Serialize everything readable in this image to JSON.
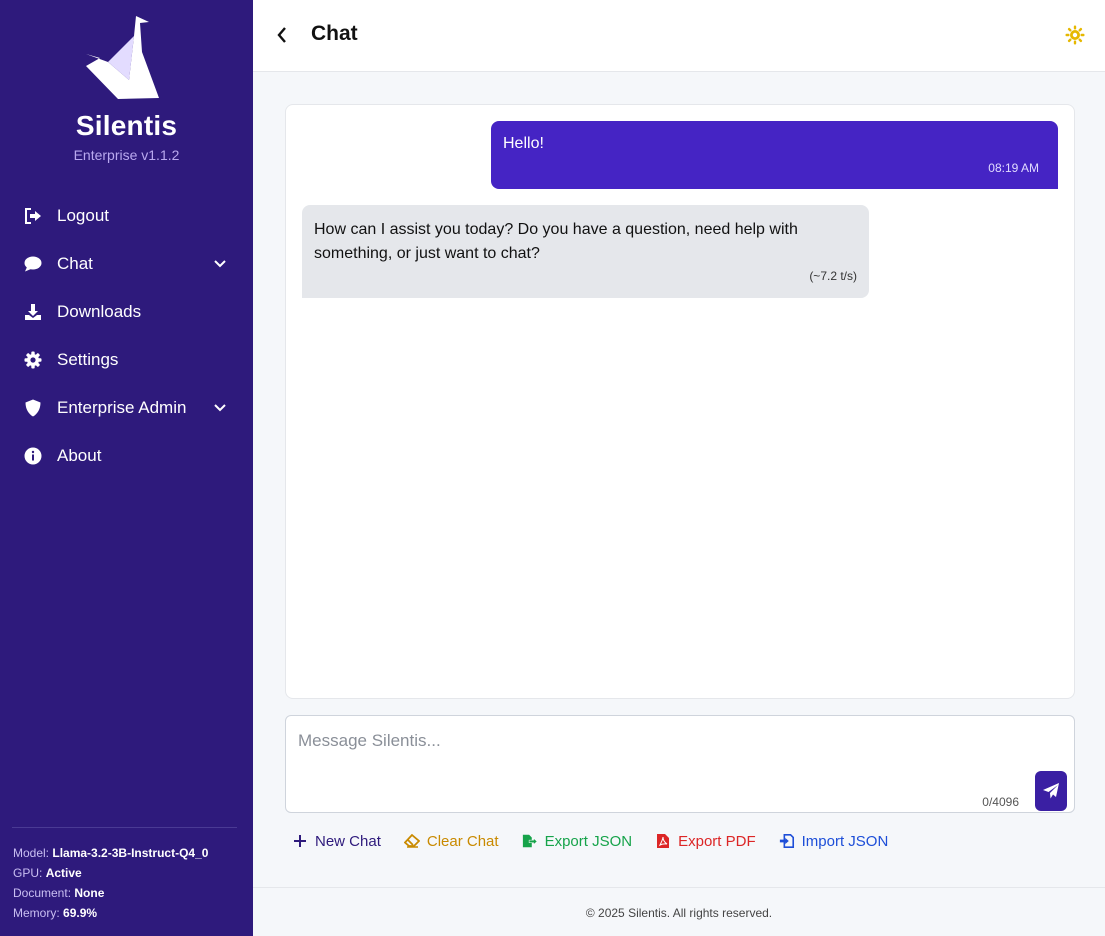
{
  "sidebar": {
    "brand": "Silentis",
    "version": "Enterprise v1.1.2",
    "items": [
      {
        "label": "Logout",
        "icon": "logout-icon"
      },
      {
        "label": "Chat",
        "icon": "chat-bubble-icon"
      },
      {
        "label": "Downloads",
        "icon": "download-icon"
      },
      {
        "label": "Settings",
        "icon": "gear-icon"
      },
      {
        "label": "Enterprise Admin",
        "icon": "shield-icon"
      },
      {
        "label": "About",
        "icon": "info-icon"
      }
    ],
    "status": {
      "model_label": "Model:",
      "model_value": "Llama-3.2-3B-Instruct-Q4_0",
      "gpu_label": "GPU:",
      "gpu_value": "Active",
      "document_label": "Document:",
      "document_value": "None",
      "memory_label": "Memory:",
      "memory_value": "69.9%"
    }
  },
  "header": {
    "title": "Chat"
  },
  "chat": {
    "messages": [
      {
        "role": "user",
        "text": "Hello!",
        "time": "08:19 AM"
      },
      {
        "role": "assistant",
        "text": "How can I assist you today? Do you have a question, need help with something, or just want to chat?",
        "rate": "(~7.2 t/s)"
      }
    ]
  },
  "input": {
    "placeholder": "Message Silentis...",
    "value": "",
    "counter": "0/4096"
  },
  "actions": {
    "new_chat": "New Chat",
    "clear_chat": "Clear Chat",
    "export_json": "Export JSON",
    "export_pdf": "Export PDF",
    "import_json": "Import JSON"
  },
  "footer": {
    "text": "© 2025 Silentis. All rights reserved."
  },
  "colors": {
    "sidebar_bg": "#2e1a7c",
    "accent": "#4524c4",
    "theme_icon": "#e6b800",
    "new_chat": "#2e1a7c",
    "clear_chat": "#c98a00",
    "export_json": "#16a34a",
    "export_pdf": "#dc2626",
    "import_json": "#1d4ed8"
  }
}
